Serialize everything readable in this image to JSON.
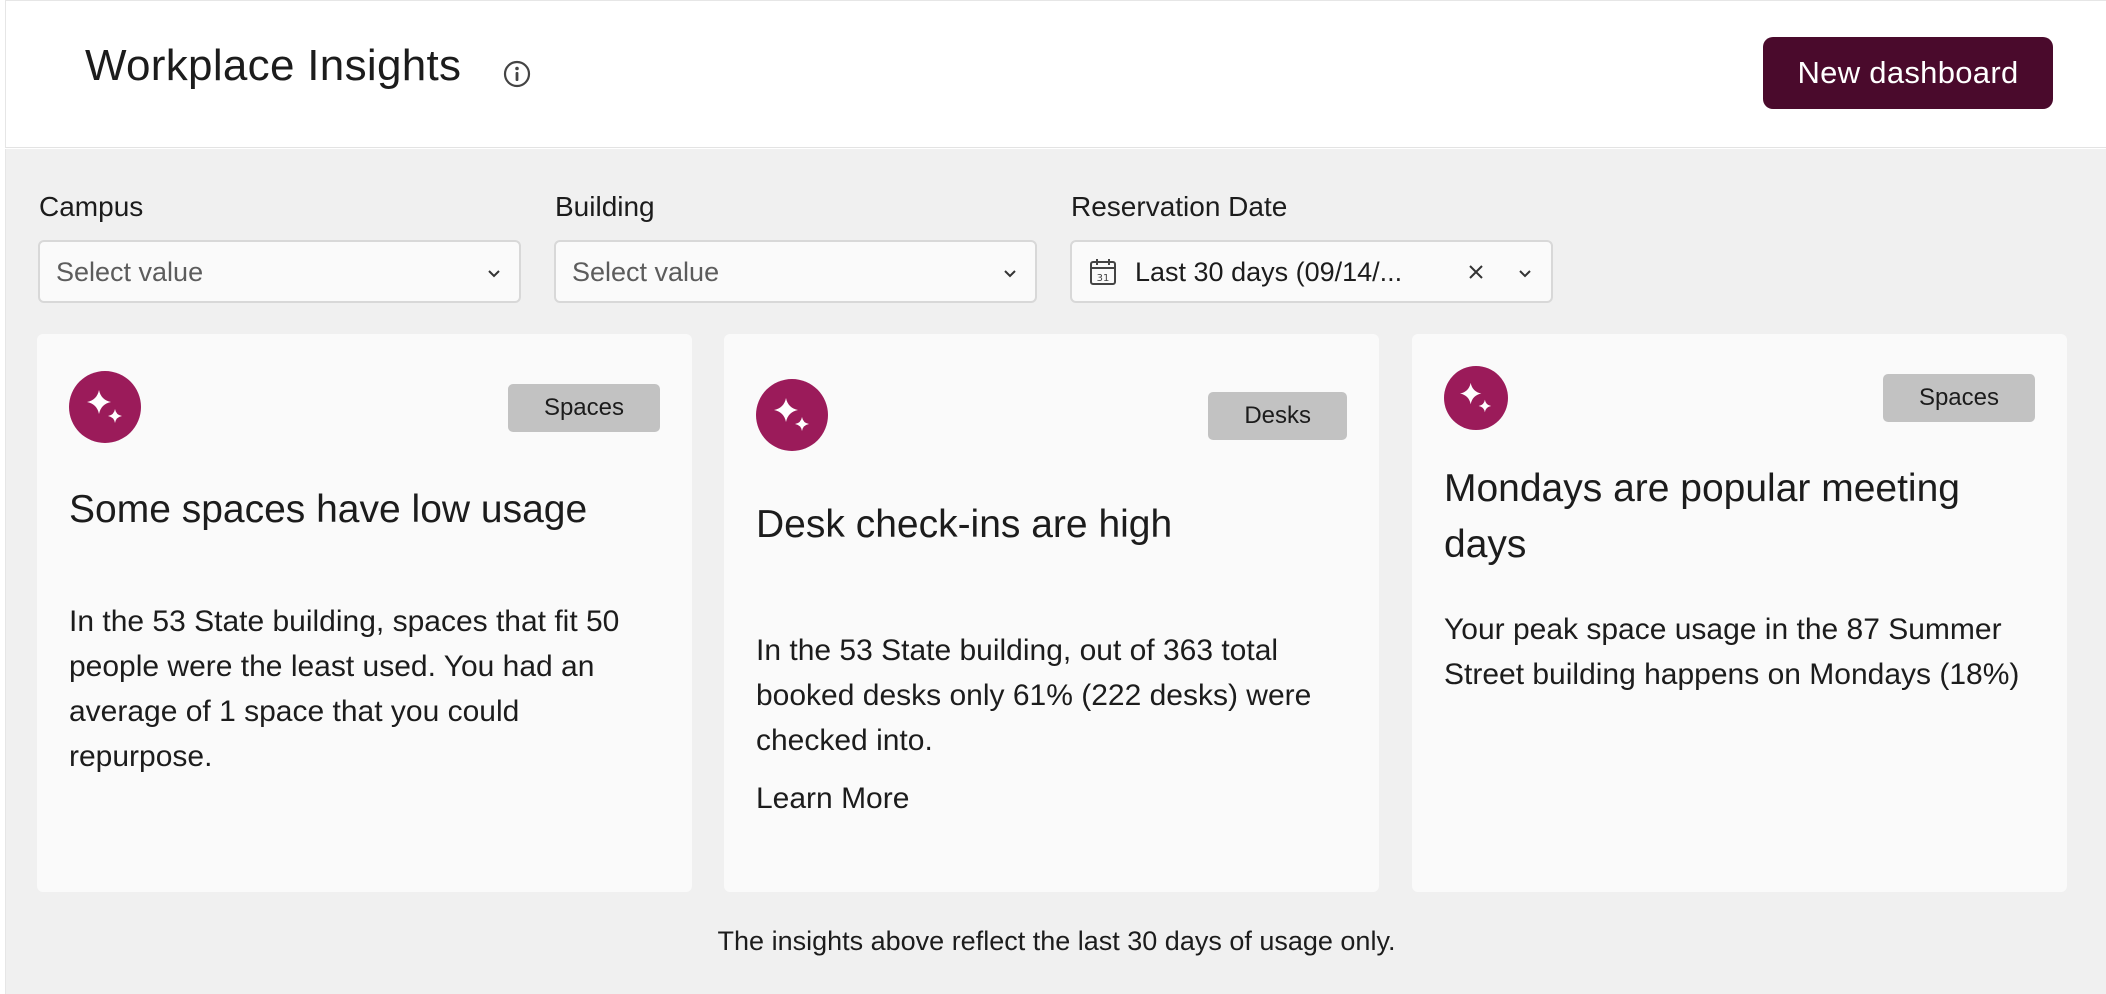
{
  "header": {
    "title": "Workplace Insights",
    "new_dashboard_label": "New dashboard"
  },
  "filters": {
    "campus": {
      "label": "Campus",
      "placeholder": "Select value"
    },
    "building": {
      "label": "Building",
      "placeholder": "Select value"
    },
    "reservation_date": {
      "label": "Reservation Date",
      "value": "Last 30 days (09/14/..."
    }
  },
  "cards": [
    {
      "icon": "sparkle-icon",
      "badge": "Spaces",
      "title": "Some spaces have low usage",
      "body": "In the 53 State building, spaces that fit 50 people were the least used. You had an average of 1 space that you could repurpose."
    },
    {
      "icon": "sparkle-icon",
      "badge": "Desks",
      "title": "Desk check-ins are high",
      "body": "In the 53 State building, out of 363 total booked desks only 61% (222 desks) were checked into.",
      "link": "Learn More"
    },
    {
      "icon": "sparkle-icon",
      "badge": "Spaces",
      "title": "Mondays are popular meeting days",
      "body": "Your peak space usage in the 87 Summer Street building happens on Mondays (18%)"
    }
  ],
  "footer_note": "The insights above reflect the last 30 days of usage only.",
  "colors": {
    "brand_primary": "#4a0a2c",
    "icon_accent": "#9b1b5a",
    "badge_bg": "#c2c2c2",
    "content_bg": "#f0f0f0",
    "card_bg": "#fafafa"
  }
}
